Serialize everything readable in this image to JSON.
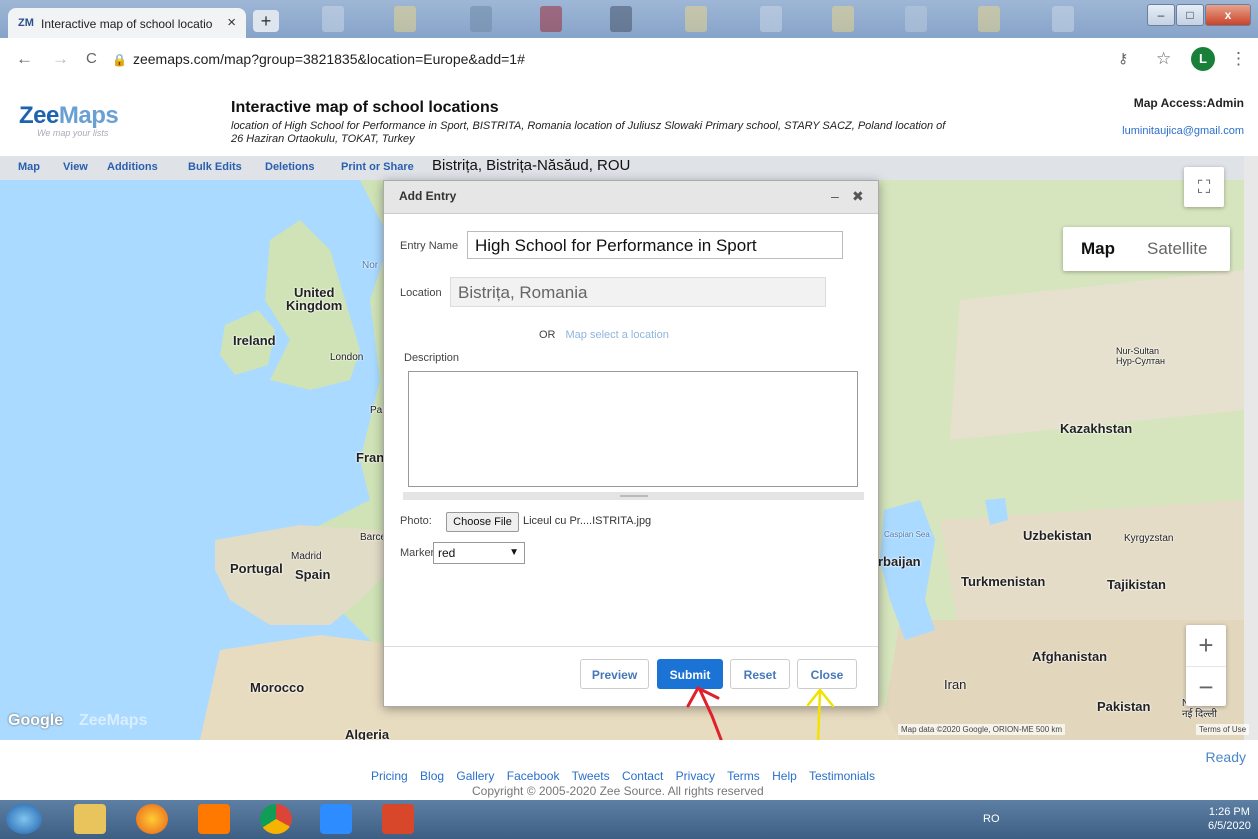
{
  "browser": {
    "tab_favicon": "ZM",
    "tab_title": "Interactive map of school locatio",
    "tab_close": "×",
    "new_tab": "+",
    "url": "zeemaps.com/map?group=3821835&location=Europe&add=1#",
    "profile_initial": "L",
    "nav": {
      "back": "←",
      "forward": "→",
      "reload": "C",
      "key_icon": "⚷",
      "star_icon": "☆",
      "menu_icon": "⋮"
    },
    "window_controls": {
      "minimize": "–",
      "maximize": "□",
      "close": "x"
    }
  },
  "header": {
    "logo_part1": "Zee",
    "logo_part2": "Maps",
    "tagline": "We map your lists",
    "map_title": "Interactive map of school locations",
    "map_description": "location of High School for Performance in Sport, BISTRITA, Romania location of Juliusz Slowaki Primary school, STARY SACZ, Poland location of 26 Haziran Ortaokulu, TOKAT, Turkey",
    "map_access": "Map Access:Admin",
    "user_email": "luminitaujica@gmail.com"
  },
  "menu": {
    "items": [
      "Map",
      "View",
      "Additions",
      "Bulk Edits",
      "Deletions",
      "Print or Share"
    ],
    "current_location": "Bistrița, Bistrița-Năsăud, ROU"
  },
  "map": {
    "type_map": "Map",
    "type_satellite": "Satellite",
    "zoom_in": "+",
    "zoom_out": "−",
    "fullscreen_icon": "⛶",
    "labels": {
      "ireland": "Ireland",
      "uk": "United\nKingdom",
      "london": "London",
      "paris": "Pari",
      "france": "Fran",
      "north_sea": "Nor",
      "portugal": "Portugal",
      "madrid": "Madrid",
      "spain": "Spain",
      "barcelona": "Barcel",
      "morocco": "Morocco",
      "algeria": "Algeria",
      "kazakhstan": "Kazakhstan",
      "nur_sultan": "Nur-Sultan\nНур-Султан",
      "uzbekistan": "Uzbekistan",
      "kyrgyzstan": "Kyrgyzstan",
      "turkmenistan": "Turkmenistan",
      "tajikistan": "Tajikistan",
      "caspian": "Caspian Sea",
      "azerbaijan": "rbaijan",
      "afghanistan": "Afghanistan",
      "iran": "Iran",
      "pakistan": "Pakistan",
      "new_delhi": "N\nनई दिल्ली"
    },
    "google_logo": "Google",
    "zeemaps_watermark": "ZeeMaps",
    "attribution": "Map data ©2020 Google, ORION-ME   500 km",
    "terms": "Terms of Use"
  },
  "dialog": {
    "title": "Add Entry",
    "minimize": "–",
    "close": "✖",
    "entry_name_label": "Entry Name",
    "entry_name_value": "High School for Performance in Sport",
    "location_label": "Location",
    "location_value": "Bistrița, Romania",
    "or_text": "OR",
    "map_select_link": "Map select a location",
    "description_label": "Description",
    "photo_label": "Photo:",
    "choose_file": "Choose File",
    "file_name": "Liceul cu Pr....ISTRITA.jpg",
    "marker_label": "Marker",
    "marker_value": "red",
    "buttons": {
      "preview": "Preview",
      "submit": "Submit",
      "reset": "Reset",
      "close": "Close"
    },
    "annotation_colors": {
      "submit_arrow": "#e0202a",
      "close_arrow": "#f2e200"
    }
  },
  "footer": {
    "status": "Ready",
    "links": [
      "Pricing",
      "Blog",
      "Gallery",
      "Facebook",
      "Tweets",
      "Contact",
      "Privacy",
      "Terms",
      "Help",
      "Testimonials"
    ],
    "copyright": "Copyright © 2005-2020 Zee Source. All rights reserved"
  },
  "taskbar": {
    "tray": "RO",
    "time": "1:26 PM",
    "date": "6/5/2020"
  }
}
